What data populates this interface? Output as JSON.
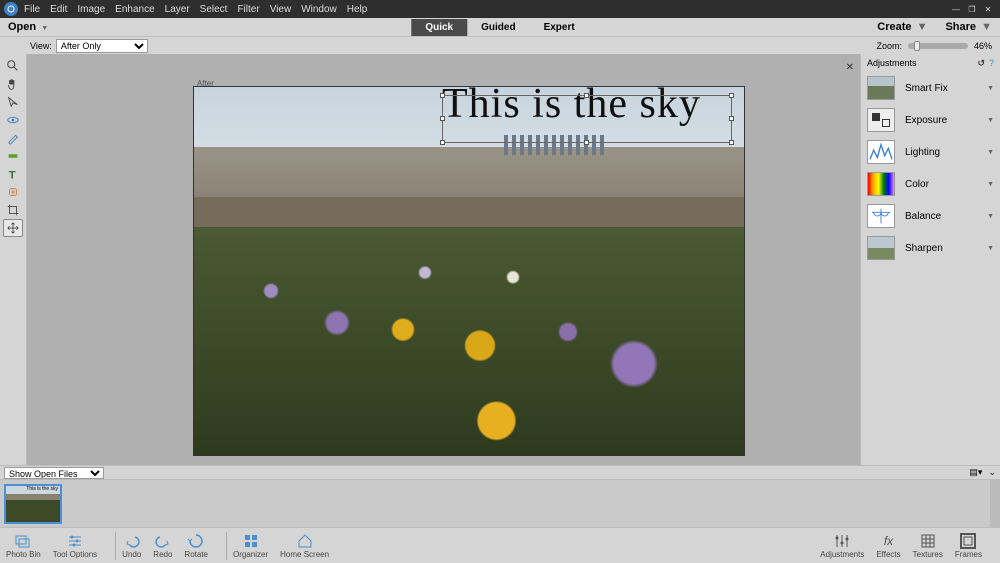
{
  "menubar": [
    "File",
    "Edit",
    "Image",
    "Enhance",
    "Layer",
    "Select",
    "Filter",
    "View",
    "Window",
    "Help"
  ],
  "open_label": "Open",
  "modes": {
    "quick": "Quick",
    "guided": "Guided",
    "expert": "Expert",
    "active": "quick"
  },
  "create_label": "Create",
  "share_label": "Share",
  "view": {
    "label": "View:",
    "value": "After Only"
  },
  "zoom": {
    "label": "Zoom:",
    "value": "46%"
  },
  "after_label": "After",
  "canvas_text": "This is the sky",
  "adjustments": {
    "header": "Adjustments",
    "items": [
      "Smart Fix",
      "Exposure",
      "Lighting",
      "Color",
      "Balance",
      "Sharpen"
    ]
  },
  "showfiles": "Show Open Files",
  "thumb_text": "This is the sky",
  "bottom": {
    "photobin": "Photo Bin",
    "tooloptions": "Tool Options",
    "undo": "Undo",
    "redo": "Redo",
    "rotate": "Rotate",
    "organizer": "Organizer",
    "home": "Home Screen",
    "adjustments": "Adjustments",
    "effects": "Effects",
    "textures": "Textures",
    "frames": "Frames"
  }
}
